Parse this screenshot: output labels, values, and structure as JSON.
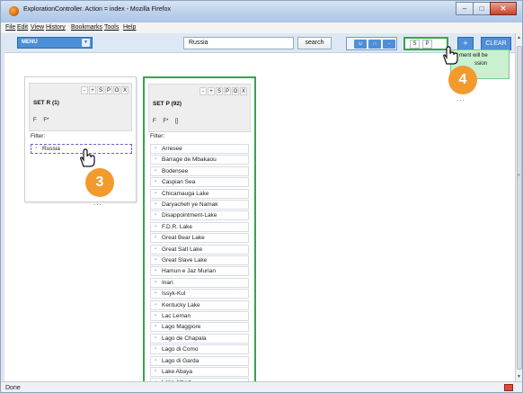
{
  "window": {
    "title": "ExplorationController. Action = index - Mozilla Firefox"
  },
  "menubar": [
    "File",
    "Edit",
    "View",
    "History",
    "Bookmarks",
    "Tools",
    "Help"
  ],
  "toolbar": {
    "menu_label": "MENU",
    "search_value": "Russia",
    "search_button": "search",
    "set_ops": [
      "∪",
      "∩",
      "-"
    ],
    "sp_buttons": [
      "S",
      "P"
    ],
    "plus_label": "+",
    "clear_label": "CLEAR",
    "tooltip_lines": [
      "ment will be",
      "ssion"
    ]
  },
  "panel_r": {
    "controls": [
      "-",
      "+",
      "S",
      "P",
      "O",
      "X"
    ],
    "title": "SET R (1)",
    "ff": [
      "F",
      "F*"
    ],
    "filter_label": "Filter:",
    "items": [
      "Russia"
    ]
  },
  "panel_p": {
    "controls": [
      "-",
      "+",
      "S",
      "P",
      "O",
      "X"
    ],
    "title": "SET P (92)",
    "ff": [
      "F",
      "F*",
      "[]"
    ],
    "filter_label": "Filter:",
    "items": [
      "Arresee",
      "Barrage de Mbakaou",
      "Bodensee",
      "Caspian Sea",
      "Chicamauga Lake",
      "Daryacheh ye Namak",
      "Disappointment-Lake",
      "F.D.R. Lake",
      "Great Bear Lake",
      "Great Salt Lake",
      "Great Slave Lake",
      "Hamun e Jaz Murian",
      "Inari",
      "Issyk-Kul",
      "Kentucky Lake",
      "Lac Leman",
      "Lago Maggiore",
      "Lago de Chapala",
      "Lago di Como",
      "Lago di Garda",
      "Lake Abaya",
      "Lake Albert"
    ]
  },
  "callouts": {
    "step_3": "3",
    "step_4": "4",
    "ellipsis": "..."
  },
  "status": {
    "text": "Done"
  },
  "colors": {
    "accent_blue": "#4f8fd8",
    "set_p_border": "#36a54a",
    "callout_orange": "#f39a2d",
    "tooltip_green": "#c9f0cf"
  }
}
